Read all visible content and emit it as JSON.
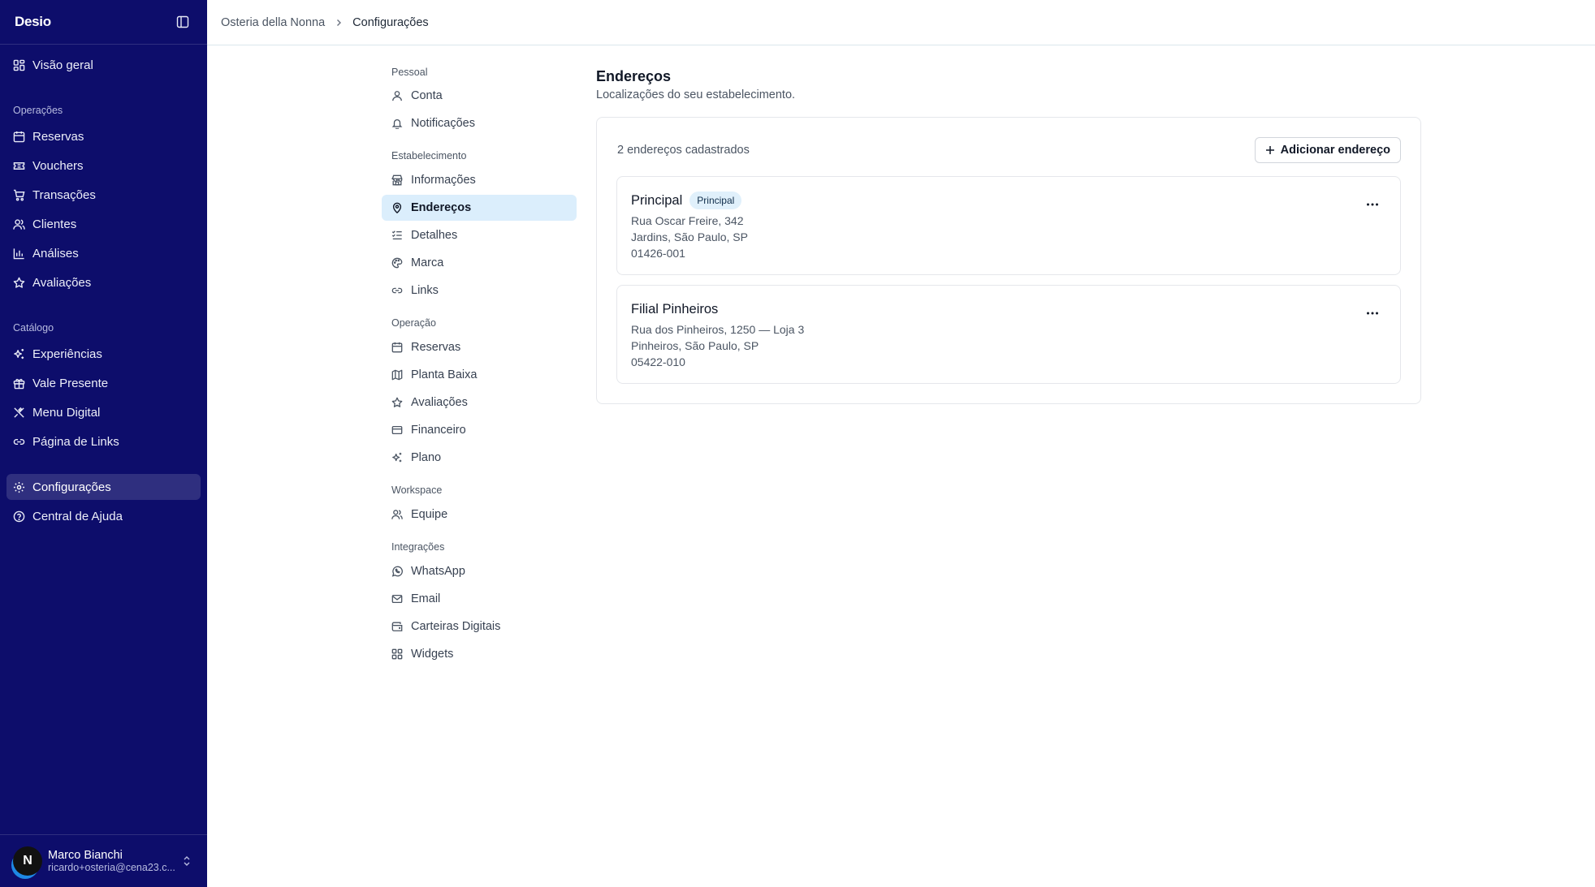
{
  "sidebar": {
    "logo": "Desio",
    "nav_top": [
      {
        "label": "Visão geral",
        "icon": "dashboard-icon"
      }
    ],
    "sections": {
      "operacoes": "Operações",
      "catalogo": "Catálogo"
    },
    "operacoes_items": [
      {
        "label": "Reservas",
        "icon": "calendar-icon"
      },
      {
        "label": "Vouchers",
        "icon": "ticket-icon"
      },
      {
        "label": "Transações",
        "icon": "cart-icon"
      },
      {
        "label": "Clientes",
        "icon": "users-icon"
      },
      {
        "label": "Análises",
        "icon": "bar-chart-icon"
      },
      {
        "label": "Avaliações",
        "icon": "star-icon"
      }
    ],
    "catalogo_items": [
      {
        "label": "Experiências",
        "icon": "sparkles-icon"
      },
      {
        "label": "Vale Presente",
        "icon": "gift-icon"
      },
      {
        "label": "Menu Digital",
        "icon": "utensils-icon"
      },
      {
        "label": "Página de Links",
        "icon": "link-icon"
      }
    ],
    "bottom_items": [
      {
        "label": "Configurações",
        "icon": "gear-icon",
        "active": true
      },
      {
        "label": "Central de Ajuda",
        "icon": "help-circle-icon"
      }
    ],
    "user": {
      "initial": "N",
      "name": "Marco Bianchi",
      "email": "ricardo+osteria@cena23.c..."
    }
  },
  "breadcrumb": {
    "parent": "Osteria della Nonna",
    "current": "Configurações"
  },
  "settings_nav": {
    "sections": [
      {
        "label": "Pessoal",
        "items": [
          {
            "label": "Conta",
            "icon": "user-icon"
          },
          {
            "label": "Notificações",
            "icon": "bell-icon"
          }
        ]
      },
      {
        "label": "Estabelecimento",
        "items": [
          {
            "label": "Informações",
            "icon": "store-icon"
          },
          {
            "label": "Endereços",
            "icon": "map-pin-icon",
            "active": true
          },
          {
            "label": "Detalhes",
            "icon": "list-checks-icon"
          },
          {
            "label": "Marca",
            "icon": "palette-icon"
          },
          {
            "label": "Links",
            "icon": "link-icon"
          }
        ]
      },
      {
        "label": "Operação",
        "items": [
          {
            "label": "Reservas",
            "icon": "calendar-icon"
          },
          {
            "label": "Planta Baixa",
            "icon": "map-icon"
          },
          {
            "label": "Avaliações",
            "icon": "star-icon"
          },
          {
            "label": "Financeiro",
            "icon": "credit-card-icon"
          },
          {
            "label": "Plano",
            "icon": "sparkles-icon"
          }
        ]
      },
      {
        "label": "Workspace",
        "items": [
          {
            "label": "Equipe",
            "icon": "users-icon"
          }
        ]
      },
      {
        "label": "Integrações",
        "items": [
          {
            "label": "WhatsApp",
            "icon": "whatsapp-icon"
          },
          {
            "label": "Email",
            "icon": "mail-icon"
          },
          {
            "label": "Carteiras Digitais",
            "icon": "wallet-icon"
          },
          {
            "label": "Widgets",
            "icon": "grid-icon"
          }
        ]
      }
    ]
  },
  "main": {
    "title": "Endereços",
    "subtitle": "Localizações do seu estabelecimento.",
    "count_text": "2 endereços cadastrados",
    "add_button_label": "Adicionar endereço",
    "addresses": [
      {
        "name": "Principal",
        "badge": "Principal",
        "line1": "Rua Oscar Freire, 342",
        "line2": "Jardins, São Paulo, SP",
        "zip": "01426-001"
      },
      {
        "name": "Filial Pinheiros",
        "badge": "",
        "line1": "Rua dos Pinheiros, 1250 — Loja 3",
        "line2": "Pinheiros, São Paulo, SP",
        "zip": "05422-010"
      }
    ]
  },
  "colors": {
    "sidebar_bg": "#0d0d6b",
    "active_subnav_bg": "#dbeefc",
    "badge_bg": "#e0f0fb"
  }
}
